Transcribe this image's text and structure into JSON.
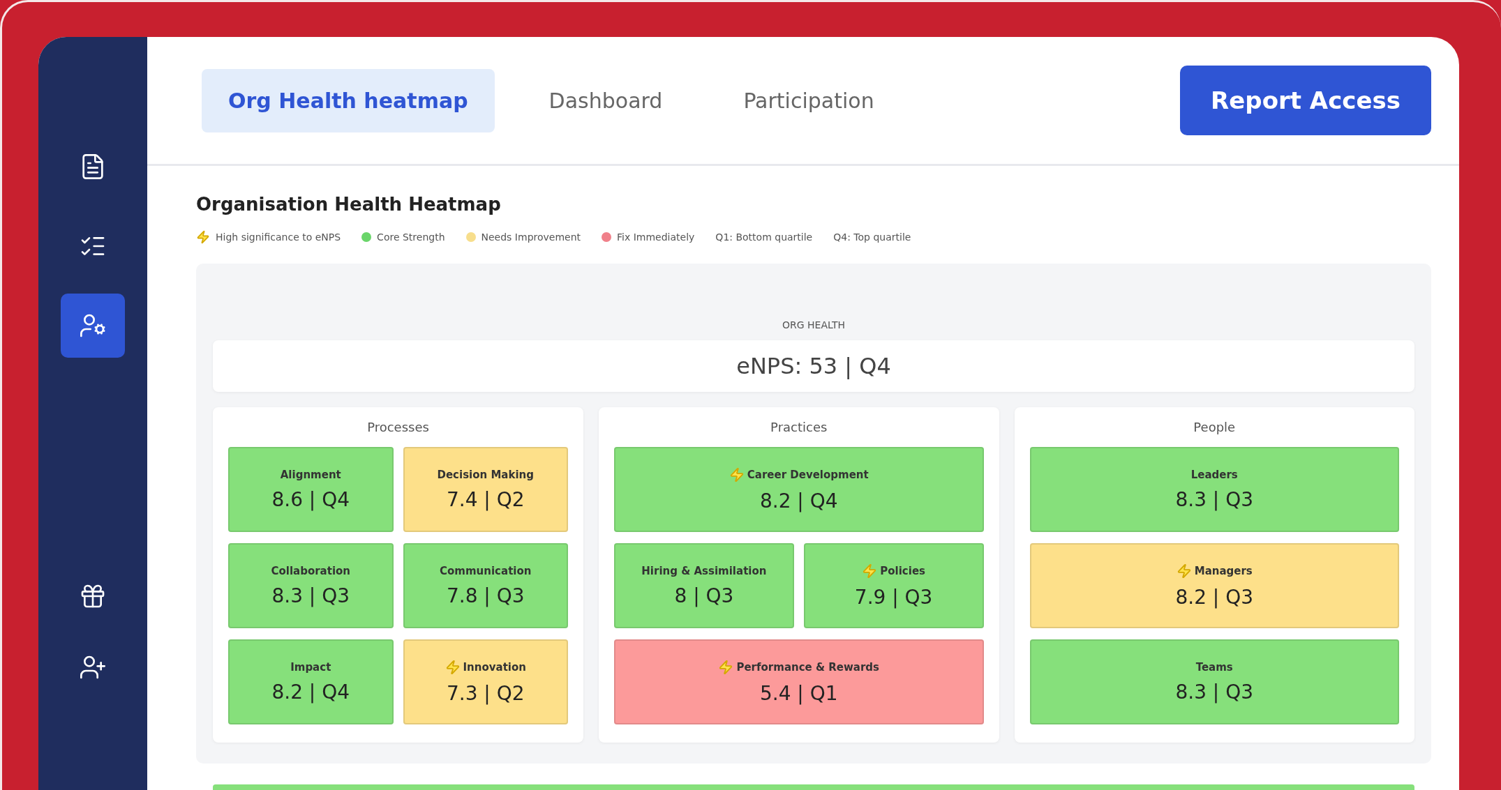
{
  "sidebar": {
    "items": [
      {
        "selected": false
      },
      {
        "selected": false
      },
      {
        "selected": true
      }
    ],
    "bottom_items": [
      {
        "selected": false
      },
      {
        "selected": false
      }
    ]
  },
  "tabs": [
    {
      "label": "Org Health heatmap",
      "selected": true
    },
    {
      "label": "Dashboard",
      "selected": false
    },
    {
      "label": "Participation",
      "selected": false
    }
  ],
  "report_button": "Report Access",
  "title": "Organisation Health Heatmap",
  "legend": [
    {
      "kind": "flag",
      "label": "High significance to eNPS"
    },
    {
      "kind": "dot",
      "color": "#6ad56a",
      "label": "Core Strength"
    },
    {
      "kind": "dot",
      "color": "#f7de8c",
      "label": "Needs Improvement"
    },
    {
      "kind": "dot",
      "color": "#f0808a",
      "label": "Fix Immediately"
    },
    {
      "kind": "text",
      "label": "Q1: Bottom quartile"
    },
    {
      "kind": "text",
      "label": "Q4: Top quartile"
    }
  ],
  "org_health": {
    "label": "ORG HEALTH",
    "value": "eNPS: 53 | Q4"
  },
  "columns": [
    {
      "title": "Processes",
      "tiles": [
        {
          "name": "Alignment",
          "score": "8.6 | Q4",
          "color": "#86e07b",
          "flagged": false,
          "wide": false
        },
        {
          "name": "Decision Making",
          "score": "7.4 | Q2",
          "color": "#fde08a",
          "flagged": false,
          "wide": false
        },
        {
          "name": "Collaboration",
          "score": "8.3 | Q3",
          "color": "#86e07b",
          "flagged": false,
          "wide": false
        },
        {
          "name": "Communication",
          "score": "7.8 | Q3",
          "color": "#86e07b",
          "flagged": false,
          "wide": false
        },
        {
          "name": "Impact",
          "score": "8.2 | Q4",
          "color": "#86e07b",
          "flagged": false,
          "wide": false
        },
        {
          "name": "Innovation",
          "score": "7.3 | Q2",
          "color": "#fde08a",
          "flagged": true,
          "wide": false
        }
      ]
    },
    {
      "title": "Practices",
      "tiles": [
        {
          "name": "Career Development",
          "score": "8.2 | Q4",
          "color": "#86e07b",
          "flagged": true,
          "wide": true
        },
        {
          "name": "Hiring & Assimilation",
          "score": "8 | Q3",
          "color": "#86e07b",
          "flagged": false,
          "wide": false
        },
        {
          "name": "Policies",
          "score": "7.9 | Q3",
          "color": "#86e07b",
          "flagged": true,
          "wide": false
        },
        {
          "name": "Performance & Rewards",
          "score": "5.4 | Q1",
          "color": "#fc9a9a",
          "flagged": true,
          "wide": true
        }
      ]
    },
    {
      "title": "People",
      "tiles": [
        {
          "name": "Leaders",
          "score": "8.3 | Q3",
          "color": "#86e07b",
          "flagged": false,
          "wide": true
        },
        {
          "name": "Managers",
          "score": "8.2 | Q3",
          "color": "#fde08a",
          "flagged": true,
          "wide": true
        },
        {
          "name": "Teams",
          "score": "8.3 | Q3",
          "color": "#86e07b",
          "flagged": false,
          "wide": true
        }
      ]
    }
  ]
}
